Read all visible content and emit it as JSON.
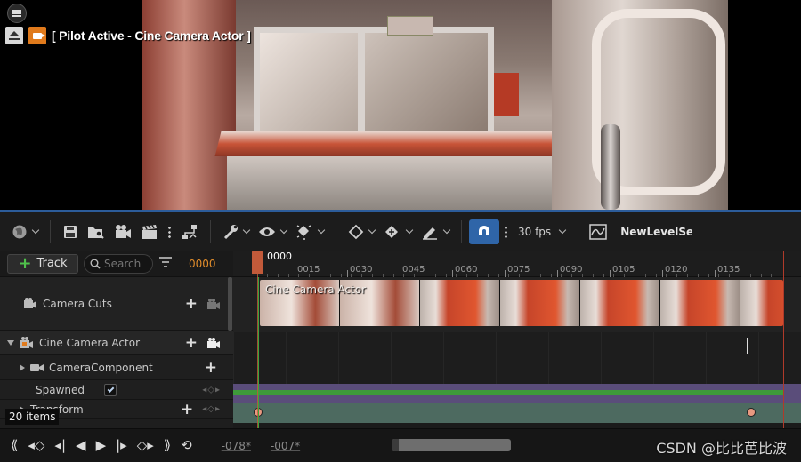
{
  "viewport": {
    "pilot_label": "[ Pilot Active - Cine Camera Actor ]"
  },
  "toolbar": {
    "fps_label": "30 fps",
    "sequence_name": "NewLevelSe",
    "accent_color": "#2f65a8"
  },
  "panel": {
    "add_track_label": "Track",
    "search_placeholder": "Search",
    "current_frame": "0000",
    "items_count": "20 items"
  },
  "tracks": {
    "camera_cuts": "Camera Cuts",
    "cine_camera_actor": "Cine Camera Actor",
    "camera_component": "CameraComponent",
    "spawned": "Spawned",
    "spawned_checked": true,
    "transform": "Transform"
  },
  "timeline": {
    "playhead_frame": "0000",
    "ruler_ticks": [
      "0015",
      "0030",
      "0045",
      "0060",
      "0075",
      "0090",
      "0105",
      "0120",
      "0135"
    ],
    "shot_label": "Cine Camera Actor"
  },
  "transport": {
    "start_range": "-078*",
    "end_range": "-007*"
  },
  "watermark": "CSDN @比比芭比波"
}
